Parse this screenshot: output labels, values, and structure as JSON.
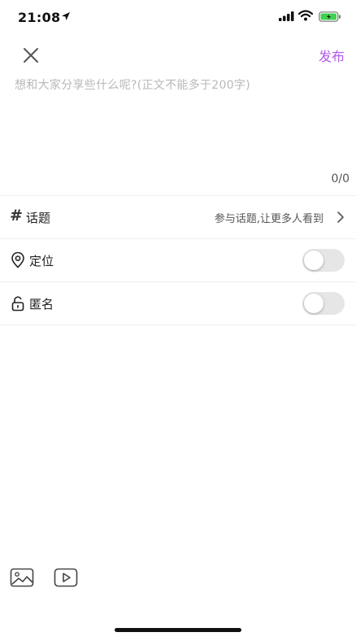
{
  "status_bar": {
    "time": "21:08"
  },
  "nav": {
    "publish_label": "发布"
  },
  "composer": {
    "placeholder": "想和大家分享些什么呢?(正文不能多于200字)",
    "counter": "0/0"
  },
  "options": {
    "topic": {
      "label": "话题",
      "hint": "参与话题,让更多人看到"
    },
    "location": {
      "label": "定位",
      "enabled": false
    },
    "anonymous": {
      "label": "匿名",
      "enabled": false
    }
  },
  "colors": {
    "accent": "#b15be8",
    "toggle_off": "#e6e6e6",
    "battery": "#3fd14d"
  },
  "icons": [
    "location-arrow-icon",
    "signal-icon",
    "wifi-icon",
    "battery-icon",
    "close-icon",
    "hash-icon",
    "chevron-right-icon",
    "location-pin-icon",
    "unlock-icon",
    "image-icon",
    "video-icon"
  ]
}
